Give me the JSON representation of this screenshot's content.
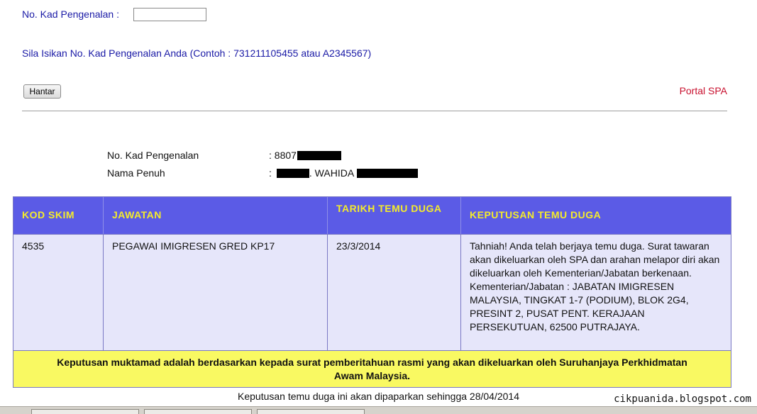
{
  "form": {
    "ic_label": "No. Kad Pengenalan :",
    "ic_value": "",
    "hint": "Sila Isikan No. Kad Pengenalan Anda (Contoh : 731211105455 atau A2345567)",
    "submit_label": "Hantar",
    "portal_link": "Portal SPA"
  },
  "applicant": {
    "ic_label": "No. Kad Pengenalan",
    "ic_value": ": 8807",
    "name_label": "Nama Penuh",
    "name_prefix": ":",
    "name_value": ". WAHIDA"
  },
  "table": {
    "headers": [
      "KOD SKIM",
      "JAWATAN",
      "TARIKH TEMU DUGA",
      "KEPUTUSAN TEMU DUGA"
    ],
    "row": {
      "kod_skim": "4535",
      "jawatan": "PEGAWAI IMIGRESEN GRED KP17",
      "tarikh": "23/3/2014",
      "keputusan": "Tahniah! Anda telah berjaya temu duga. Surat tawaran akan dikeluarkan oleh SPA dan arahan melapor diri akan dikeluarkan oleh Kementerian/Jabatan berkenaan. Kementerian/Jabatan : JABATAN IMIGRESEN MALAYSIA, TINGKAT 1-7 (PODIUM), BLOK 2G4, PRESINT 2, PUSAT PENT. KERAJAAN PERSEKUTUAN, 62500 PUTRAJAYA."
    },
    "notice": "Keputusan muktamad adalah berdasarkan kepada surat pemberitahuan rasmi yang akan dikeluarkan oleh Suruhanjaya Perkhidmatan Awam Malaysia."
  },
  "footer": {
    "display_until": "Keputusan temu duga ini akan dipaparkan sehingga 28/04/2014",
    "watermark": "cikpuanida.blogspot.com"
  },
  "colors": {
    "header_bg": "#5b5be6",
    "header_text": "#f5ec2a",
    "row_bg": "#e6e6fa",
    "notice_bg": "#f9f962",
    "form_text": "#1a1aa6",
    "link": "#c8102e"
  }
}
